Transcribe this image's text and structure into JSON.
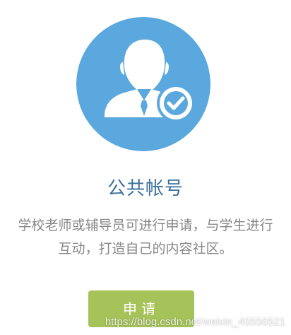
{
  "card": {
    "icon": "user-with-checkmark-icon",
    "icon_bg_color": "#5aa8dd",
    "title": "公共帐号",
    "description_lines": [
      "学校老师或辅导员可进行申请，与学生进行",
      "互动，打造自己的内容社区。"
    ],
    "button_label": "申请",
    "button_color": "#a6c35a"
  },
  "watermark": "https://blog.csdn.net/weixin_45556521"
}
